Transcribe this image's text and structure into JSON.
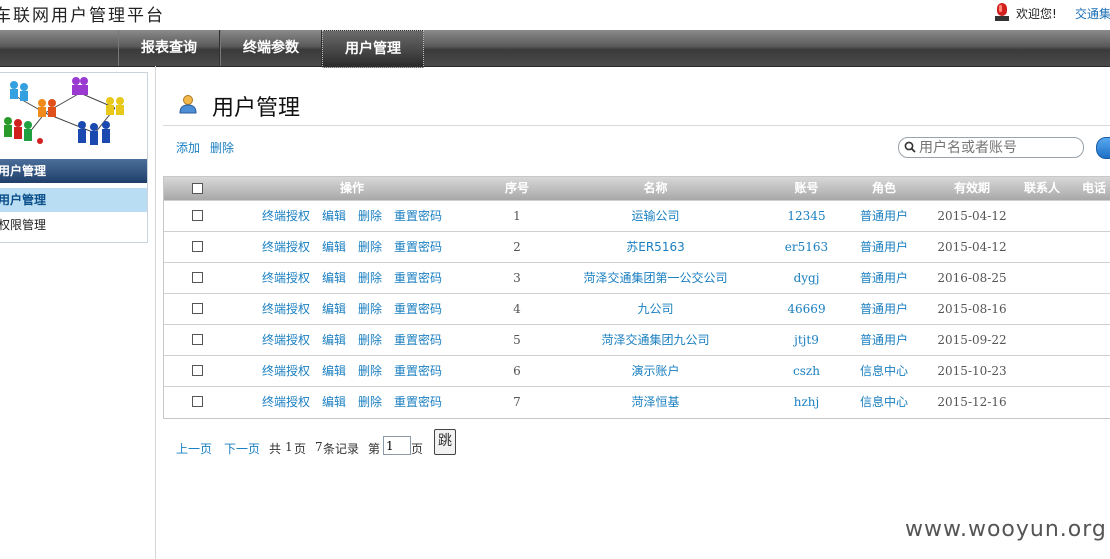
{
  "header": {
    "app_title": "车联网用户管理平台",
    "welcome": "欢迎您!",
    "user_link": "交通集团"
  },
  "nav": {
    "items": [
      {
        "label": "报表查询"
      },
      {
        "label": "终端参数"
      },
      {
        "label": "用户管理"
      }
    ],
    "active_index": 2
  },
  "sidebar": {
    "section_title": "用户管理",
    "items": [
      {
        "label": "用户管理",
        "active": true
      },
      {
        "label": "权限管理",
        "active": false
      }
    ]
  },
  "main": {
    "title": "用户管理",
    "add_label": "添加",
    "delete_label": "删除",
    "search_placeholder": "用户名或者账号"
  },
  "table": {
    "headers": {
      "ops": "操作",
      "seq": "序号",
      "name": "名称",
      "account": "账号",
      "role": "角色",
      "expiry": "有效期",
      "contact": "联系人",
      "phone": "电话"
    },
    "op_labels": [
      "终端授权",
      "编辑",
      "删除",
      "重置密码"
    ],
    "rows": [
      {
        "seq": "1",
        "name": "运输公司",
        "account": "12345",
        "role": "普通用户",
        "expiry": "2015-04-12"
      },
      {
        "seq": "2",
        "name": "苏ER5163",
        "account": "er5163",
        "role": "普通用户",
        "expiry": "2015-04-12"
      },
      {
        "seq": "3",
        "name": "菏泽交通集团第一公交公司",
        "account": "dygj",
        "role": "普通用户",
        "expiry": "2016-08-25"
      },
      {
        "seq": "4",
        "name": "九公司",
        "account": "46669",
        "role": "普通用户",
        "expiry": "2015-08-16"
      },
      {
        "seq": "5",
        "name": "菏泽交通集团九公司",
        "account": "jtjt9",
        "role": "普通用户",
        "expiry": "2015-09-22"
      },
      {
        "seq": "6",
        "name": "演示账户",
        "account": "cszh",
        "role": "信息中心",
        "expiry": "2015-10-23"
      },
      {
        "seq": "7",
        "name": "菏泽恒基",
        "account": "hzhj",
        "role": "信息中心",
        "expiry": "2015-12-16"
      }
    ]
  },
  "pager": {
    "prev": "上一页",
    "next": "下一页",
    "total_pages_prefix": "共",
    "total_pages": "1",
    "total_pages_suffix": "页",
    "records_count": "7",
    "records_suffix": "条记录",
    "page_prefix": "第",
    "page_value": "1",
    "page_suffix": "页",
    "go_label": "跳"
  },
  "watermark": "www.wooyun.org",
  "colors": {
    "link": "#1a7fc0",
    "nav_dark": "#3a3a3a",
    "sidebar_head": "#1f3f6a",
    "sidebar_active": "#b9ddf2"
  }
}
